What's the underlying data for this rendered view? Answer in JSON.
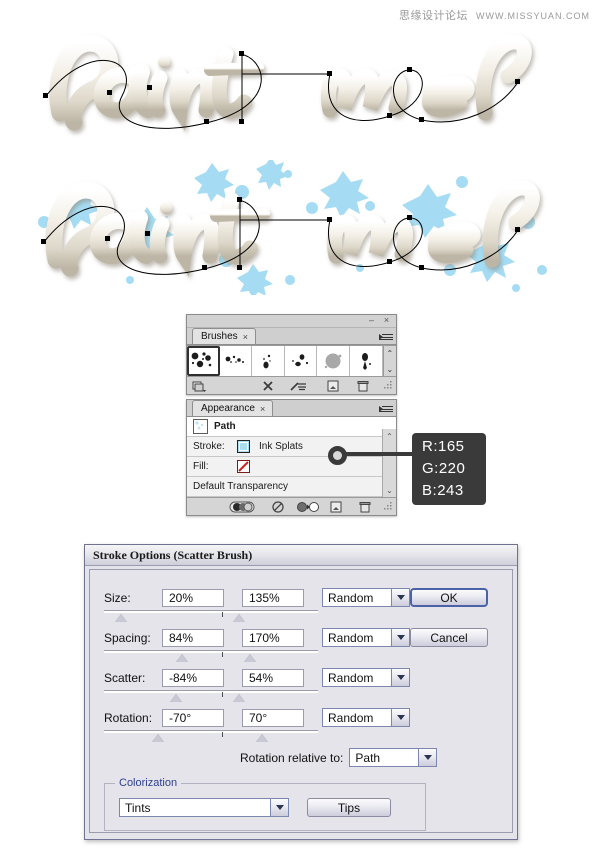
{
  "watermark": {
    "cn": "思缘设计论坛",
    "en": "WWW.MISSYUAN.COM"
  },
  "artwork": {
    "line1_text": "Paint me",
    "line2_text": "Paint me",
    "paint_color": "#efeae1",
    "splat_color": "#a5dcf3",
    "path_color": "#000000"
  },
  "brushes_panel": {
    "tab_label": "Brushes",
    "close_glyph": "×",
    "minimize_glyph": "–",
    "window_close_glyph": "×",
    "scroll_up_glyph": "⌃",
    "scroll_down_glyph": "⌄",
    "brushes": [
      {
        "name": "ink-splats-brush",
        "selected": true
      },
      {
        "name": "splatter-brush-2",
        "selected": false
      },
      {
        "name": "drip-brush-3",
        "selected": false
      },
      {
        "name": "spatter-brush-4",
        "selected": false
      },
      {
        "name": "blob-brush-5",
        "selected": false
      },
      {
        "name": "drop-brush-6",
        "selected": false
      }
    ],
    "footer_icons": [
      "brush-libraries-icon",
      "remove-brush-icon",
      "brush-options-icon",
      "new-brush-icon",
      "delete-brush-icon",
      "resize-grip-icon"
    ]
  },
  "appearance_panel": {
    "tab_label": "Appearance",
    "close_glyph": "×",
    "item_title": "Path",
    "rows": [
      {
        "label": "Stroke:",
        "value": "Ink Splats",
        "swatch": "#aadcf2"
      },
      {
        "label": "Fill:",
        "value": "",
        "swatch": "none"
      }
    ],
    "transparency_label": "Default Transparency",
    "scroll_up_glyph": "⌃",
    "scroll_down_glyph": "⌄",
    "footer_icons": [
      "new-art-has-basic-appearance-icon",
      "clear-appearance-icon",
      "reduce-to-basic-appearance-icon",
      "duplicate-item-icon",
      "delete-item-icon",
      "resize-grip-icon"
    ]
  },
  "rgb_callout": {
    "r_label": "R:",
    "r_value": "165",
    "g_label": "G:",
    "g_value": "220",
    "b_label": "B:",
    "b_value": "243",
    "hex": "#a5dcf3",
    "background": "#3a3a3a"
  },
  "stroke_dialog": {
    "title": "Stroke Options (Scatter Brush)",
    "fields": [
      {
        "label": "Size:",
        "min_value": "20%",
        "max_value": "135%",
        "mode": "Random",
        "thumb_left_pct": 8,
        "thumb_right_pct": 63,
        "tick_pct": 55
      },
      {
        "label": "Spacing:",
        "min_value": "84%",
        "max_value": "170%",
        "mode": "Random",
        "thumb_left_pct": 36,
        "thumb_right_pct": 68,
        "tick_pct": 55
      },
      {
        "label": "Scatter:",
        "min_value": "-84%",
        "max_value": "54%",
        "mode": "Random",
        "thumb_left_pct": 33,
        "thumb_right_pct": 63,
        "tick_pct": 55
      },
      {
        "label": "Rotation:",
        "min_value": "-70°",
        "max_value": "70°",
        "mode": "Random",
        "thumb_left_pct": 24,
        "thumb_right_pct": 72,
        "tick_pct": 55
      }
    ],
    "rotation_relative_label": "Rotation relative to:",
    "rotation_relative_value": "Path",
    "colorization_legend": "Colorization",
    "colorization_value": "Tints",
    "tips_button": "Tips",
    "ok_button": "OK",
    "cancel_button": "Cancel",
    "dropdown_arrow_glyph": "▼"
  }
}
